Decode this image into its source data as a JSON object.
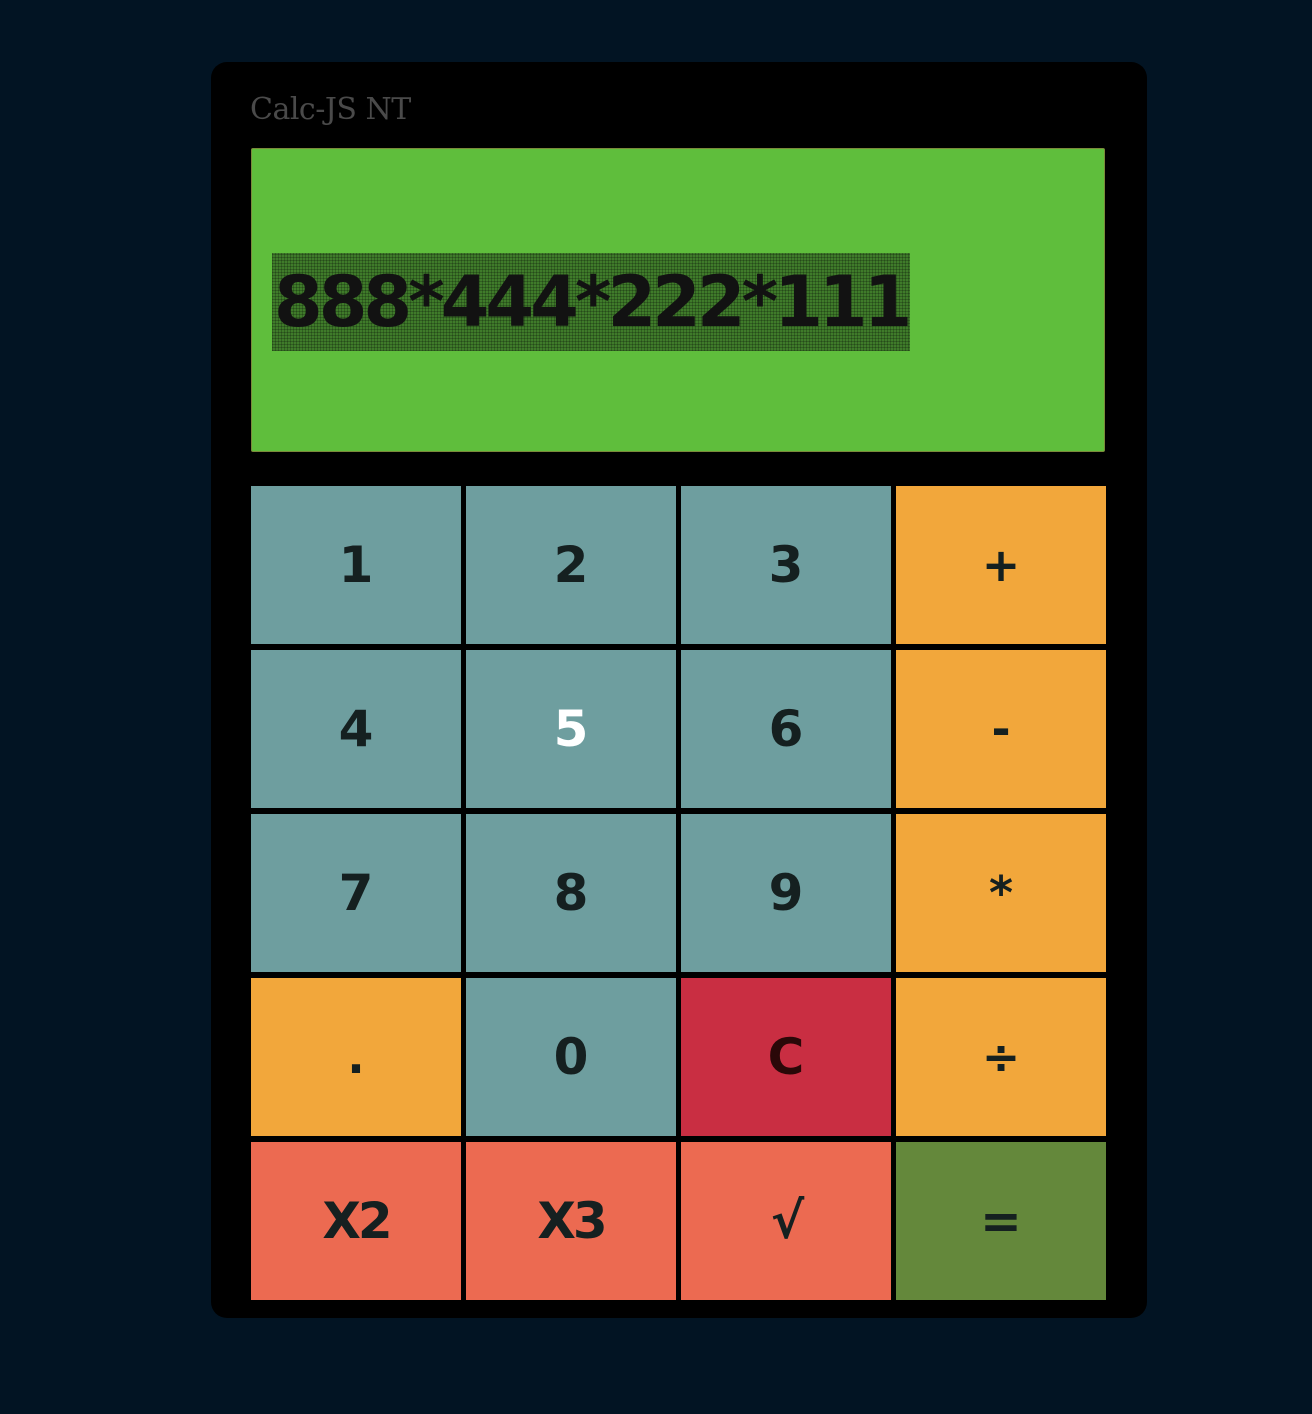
{
  "app": {
    "title": "Calc-JS NT"
  },
  "display": {
    "value": "888*444*222*111"
  },
  "keys": [
    {
      "id": "1",
      "label": "1"
    },
    {
      "id": "2",
      "label": "2"
    },
    {
      "id": "3",
      "label": "3"
    },
    {
      "id": "plus",
      "label": "+"
    },
    {
      "id": "4",
      "label": "4"
    },
    {
      "id": "5",
      "label": "5"
    },
    {
      "id": "6",
      "label": "6"
    },
    {
      "id": "minus",
      "label": "-"
    },
    {
      "id": "7",
      "label": "7"
    },
    {
      "id": "8",
      "label": "8"
    },
    {
      "id": "9",
      "label": "9"
    },
    {
      "id": "multiply",
      "label": "*"
    },
    {
      "id": "decimal",
      "label": "."
    },
    {
      "id": "0",
      "label": "0"
    },
    {
      "id": "clear",
      "label": "C"
    },
    {
      "id": "divide",
      "label": "÷"
    },
    {
      "id": "square",
      "label": "X2"
    },
    {
      "id": "cube",
      "label": "X3"
    },
    {
      "id": "sqrt",
      "label": "√"
    },
    {
      "id": "equals",
      "label": "="
    }
  ],
  "colors": {
    "background": "#021423",
    "display": "#5fbe3c",
    "number_key": "#6e9e9f",
    "operator_key": "#f2a73b",
    "clear_key": "#c92e42",
    "function_key": "#ec6a51",
    "equals_key": "#64883b"
  }
}
